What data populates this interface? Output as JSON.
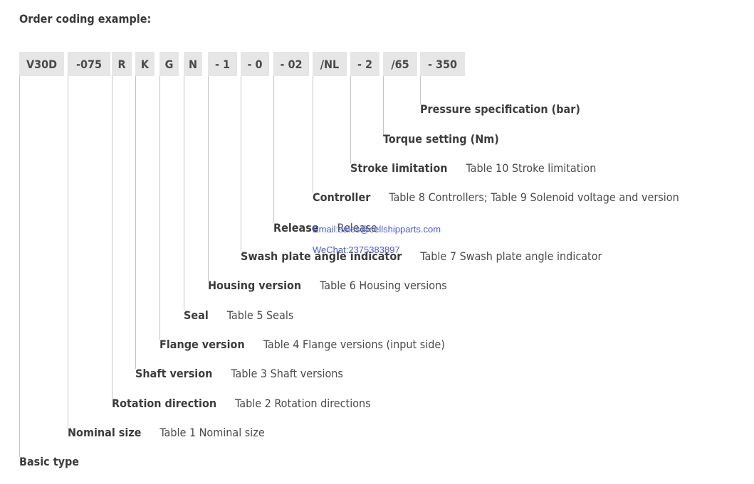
{
  "heading": "Order coding example:",
  "code_segments": [
    {
      "text": "V30D"
    },
    {
      "text": "-075"
    },
    {
      "text": "R"
    },
    {
      "text": "K"
    },
    {
      "text": "G"
    },
    {
      "text": "N"
    },
    {
      "text": "- 1"
    },
    {
      "text": "- 0"
    },
    {
      "text": "- 02"
    },
    {
      "text": "/NL"
    },
    {
      "text": "- 2"
    },
    {
      "text": "/65"
    },
    {
      "text": "- 350"
    }
  ],
  "rows": [
    {
      "name": "Pressure specification (bar)",
      "ref": ""
    },
    {
      "name": "Torque setting (Nm)",
      "ref": ""
    },
    {
      "name": "Stroke limitation",
      "ref": "Table 10 Stroke limitation"
    },
    {
      "name": "Controller",
      "ref": "Table 8 Controllers; Table 9 Solenoid voltage and version"
    },
    {
      "name": "Release",
      "ref": "Release"
    },
    {
      "name": "Swash plate angle indicator",
      "ref": "Table 7 Swash plate angle indicator"
    },
    {
      "name": "Housing version",
      "ref": "Table 6 Housing versions"
    },
    {
      "name": "Seal",
      "ref": "Table 5 Seals"
    },
    {
      "name": "Flange version",
      "ref": "Table 4 Flange versions (input side)"
    },
    {
      "name": "Shaft version",
      "ref": "Table 3 Shaft versions"
    },
    {
      "name": "Rotation direction",
      "ref": "Table 2 Rotation directions"
    },
    {
      "name": "Nominal size",
      "ref": "Table 1 Nominal size"
    },
    {
      "name": "Basic type",
      "ref": ""
    }
  ],
  "watermark": {
    "email": "Email:sales@cellshipparts.com",
    "wechat": "WeChat:2375383897"
  }
}
